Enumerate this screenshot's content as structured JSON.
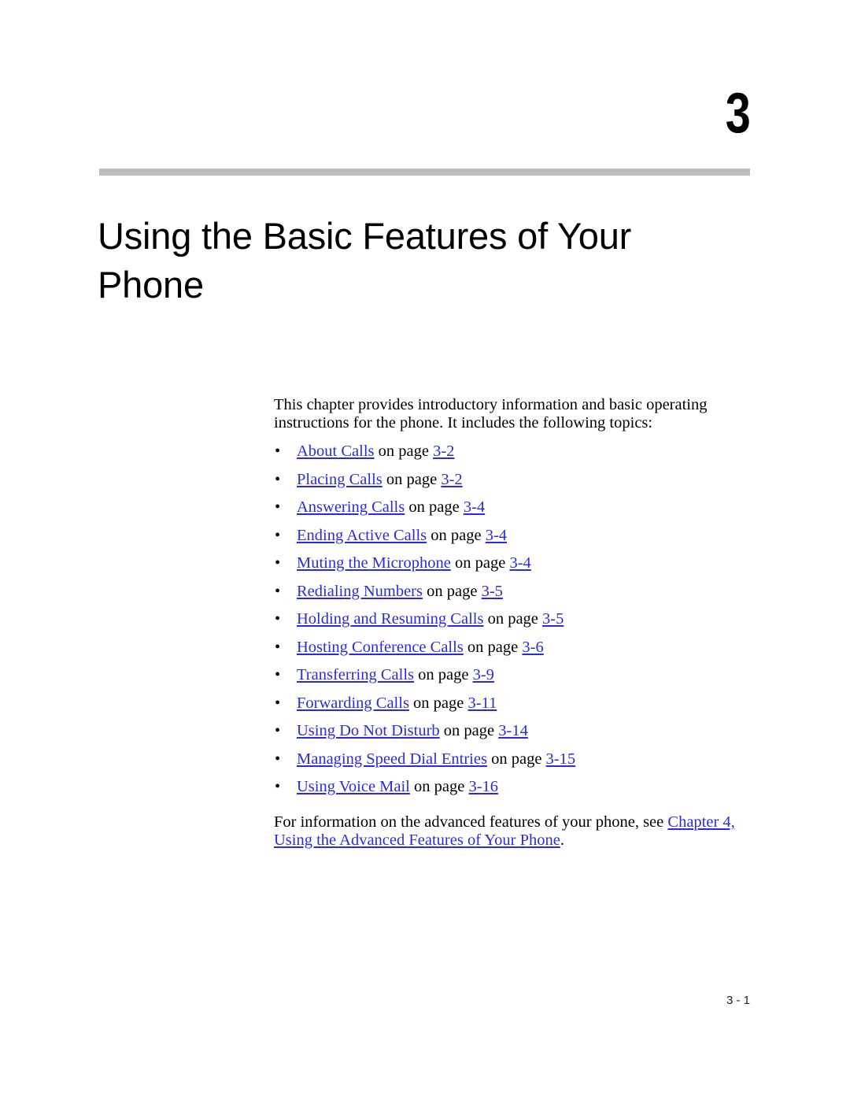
{
  "chapter": {
    "number": "3",
    "title": "Using the Basic Features of Your Phone",
    "rule_color": "#bdbdbd"
  },
  "body": {
    "intro_paragraph": "This chapter provides introductory information and basic operating instructions for the phone. It includes the following topics:",
    "bullet_glyph": "•",
    "on_page_label": "on page",
    "link_color": "#2b2bdd",
    "topics": [
      {
        "title": "About Calls",
        "page": "3-2"
      },
      {
        "title": "Placing Calls",
        "page": "3-2"
      },
      {
        "title": "Answering Calls",
        "page": "3-4"
      },
      {
        "title": "Ending Active Calls",
        "page": "3-4"
      },
      {
        "title": "Muting the Microphone",
        "page": "3-4"
      },
      {
        "title": "Redialing Numbers",
        "page": "3-5"
      },
      {
        "title": "Holding and Resuming Calls",
        "page": "3-5"
      },
      {
        "title": "Hosting Conference Calls",
        "page": "3-6"
      },
      {
        "title": "Transferring Calls",
        "page": "3-9"
      },
      {
        "title": "Forwarding Calls",
        "page": "3-11"
      },
      {
        "title": "Using Do Not Disturb",
        "page": "3-14"
      },
      {
        "title": "Managing Speed Dial Entries",
        "page": "3-15"
      },
      {
        "title": "Using Voice Mail",
        "page": "3-16"
      }
    ],
    "closing": {
      "lead_text": "For information on the advanced features of your phone, see ",
      "link_text": "Chapter 4, Using the Advanced Features of Your Phone",
      "trailing_text": "."
    }
  },
  "footer": {
    "page_label": "3 - 1"
  }
}
